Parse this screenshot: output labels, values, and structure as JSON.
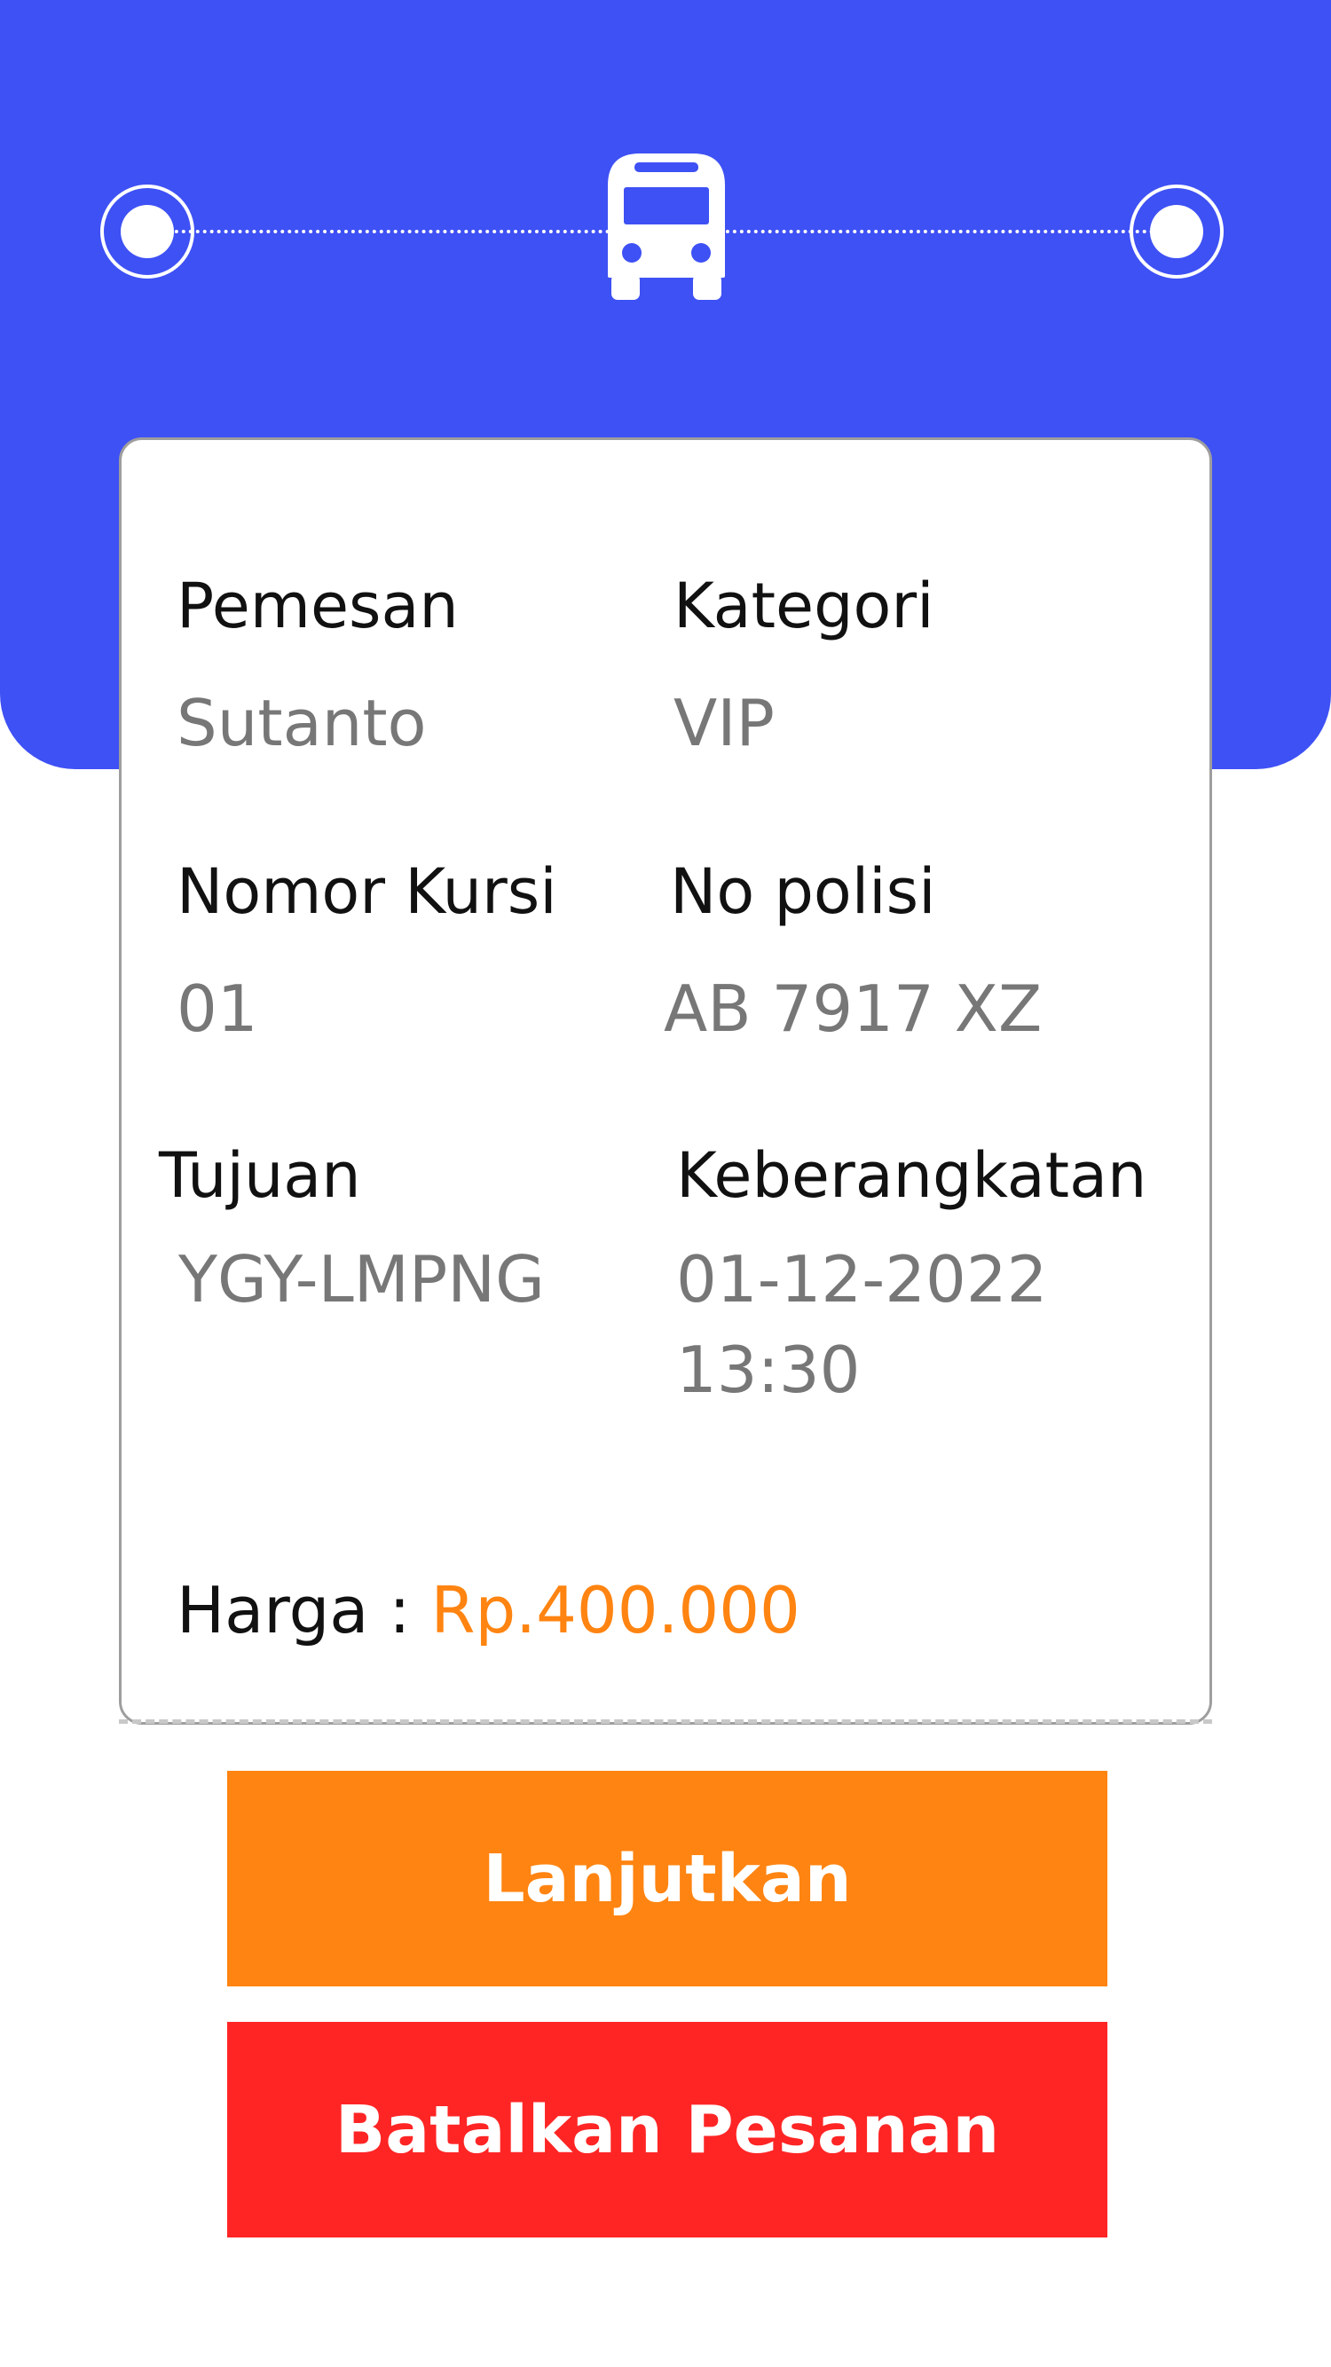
{
  "booking": {
    "customer_label": "Pemesan",
    "customer_value": "Sutanto",
    "category_label": "Kategori",
    "category_value": "VIP",
    "seat_label": "Nomor Kursi",
    "seat_value": "01",
    "plate_label": "No polisi",
    "plate_value": "AB 7917 XZ",
    "route_label": "Tujuan",
    "route_value": "YGY-LMPNG",
    "departure_label": "Keberangkatan",
    "departure_date": "01-12-2022",
    "departure_time": "13:30",
    "price_label": "Harga : ",
    "price_value": "Rp.400.000"
  },
  "actions": {
    "continue_label": "Lanjutkan",
    "cancel_label": "Batalkan Pesanan"
  },
  "icons": {
    "transport": "bus-icon",
    "origin": "origin-stop-icon",
    "destination": "destination-stop-icon"
  },
  "colors": {
    "header": "#3e51f4",
    "accent": "#ff8411",
    "danger": "#ff2525",
    "value_text": "#777777"
  }
}
